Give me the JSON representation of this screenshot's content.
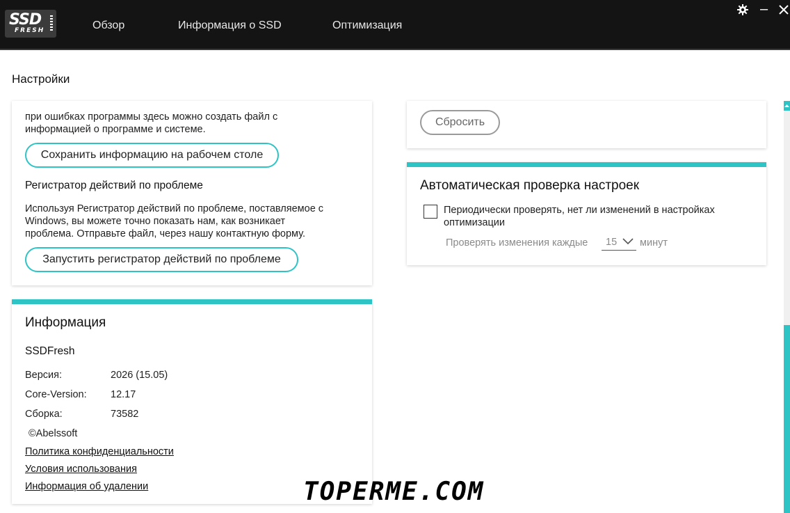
{
  "app": {
    "logo_top": "SSD",
    "logo_bottom": "FRESH"
  },
  "nav": {
    "items": [
      "Обзор",
      "Информация о SSD",
      "Оптимизация"
    ]
  },
  "window_controls": {
    "settings_icon": "gear-icon",
    "close_icon": "close-icon"
  },
  "page": {
    "title": "Настройки"
  },
  "support_card": {
    "intro_line1": "при ошибках программы здесь можно создать файл с",
    "intro_line2": "информацией о программе и системе.",
    "save_button": "Сохранить информацию на рабочем столе",
    "recorder_heading": "Регистратор действий по проблеме",
    "recorder_line1": "Используя Регистратор действий по проблеме, поставляемое с",
    "recorder_line2": "Windows, вы можете точно показать нам, как возникает",
    "recorder_line3": "проблема. Отправьте файл, через нашу контактную форму.",
    "recorder_button": "Запустить регистратор действий по проблеме"
  },
  "info_card": {
    "heading": "Информация",
    "product": "SSDFresh",
    "rows": [
      {
        "label": "Версия:",
        "value": "2026 (15.05)"
      },
      {
        "label": "Core-Version:",
        "value": "12.17"
      },
      {
        "label": "Сборка:",
        "value": "73582"
      }
    ],
    "copyright": "©Abelssoft",
    "links": [
      "Политика конфиденциальности",
      "Условия использования",
      "Информация об удалении"
    ]
  },
  "reset_card": {
    "reset_button": "Сбросить"
  },
  "auto_check_card": {
    "heading": "Автоматическая проверка настроек",
    "checkbox_label_line1": "Периодически проверять, нет ли изменений в настройках",
    "checkbox_label_line2": "оптимизации",
    "checked": false,
    "interval_prefix": "Проверять изменения каждые",
    "interval_value": "15",
    "interval_suffix": "минут"
  },
  "colors": {
    "accent": "#2ec4c6",
    "topbar": "#141414"
  },
  "watermark": "TOPERME.COM"
}
